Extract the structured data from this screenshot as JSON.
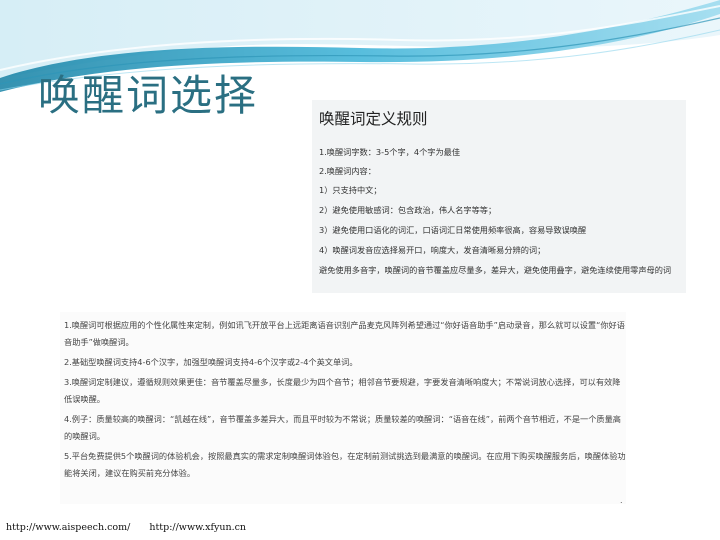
{
  "slide": {
    "title": "唤醒词选择",
    "rules": {
      "heading": "唤醒词定义规则",
      "items": [
        "1.唤醒词字数：3-5个字，4个字为最佳",
        "2.唤醒词内容：",
        "1）只支持中文；",
        "2）避免使用敏感词：包含政治，伟人名字等等；",
        "3）避免使用口语化的词汇，口语词汇日常使用频率很高，容易导致误唤醒",
        "4）唤醒词发音应选择易开口，响度大，发音清晰易分辨的词；",
        "避免使用多音字，唤醒词的音节覆盖应尽量多，差异大，避免使用叠字，避免连续使用零声母的词"
      ]
    },
    "notes": [
      "1.唤醒词可根据应用的个性化属性来定制，例如讯飞开放平台上远距离语音识别产品麦克风阵列希望通过“你好语音助手”启动录音，那么就可以设置“你好语音助手”做唤醒词。",
      "2.基础型唤醒词支持4-6个汉字，加强型唤醒词支持4-6个汉字或2-4个英文单词。",
      "3.唤醒词定制建议，遵循规则效果更佳：音节覆盖尽量多，长度最少为四个音节；相邻音节要规避，字要发音清晰响度大；不常说词放心选择，可以有效降低误唤醒。",
      "4.例子：质量较高的唤醒词：“凯越在线”，音节覆盖多差异大，而且平时较为不常说；质量较差的唤醒词：“语音在线”，前两个音节相近，不是一个质量高的唤醒词。",
      "5.平台免费提供5个唤醒词的体验机会，按照最真实的需求定制唤醒词体验包，在定制前测试挑选到最满意的唤醒词。在应用下购买唤醒服务后，唤醒体验功能将关闭，建议在购买前充分体验。"
    ],
    "footer": {
      "link1": "http://www.aispeech.com/",
      "link2": "http://www.xfyun.cn"
    },
    "colors": {
      "title": "#2a6f82",
      "banner_dark": "#1f86a8",
      "banner_light": "#7fd0ea"
    }
  }
}
